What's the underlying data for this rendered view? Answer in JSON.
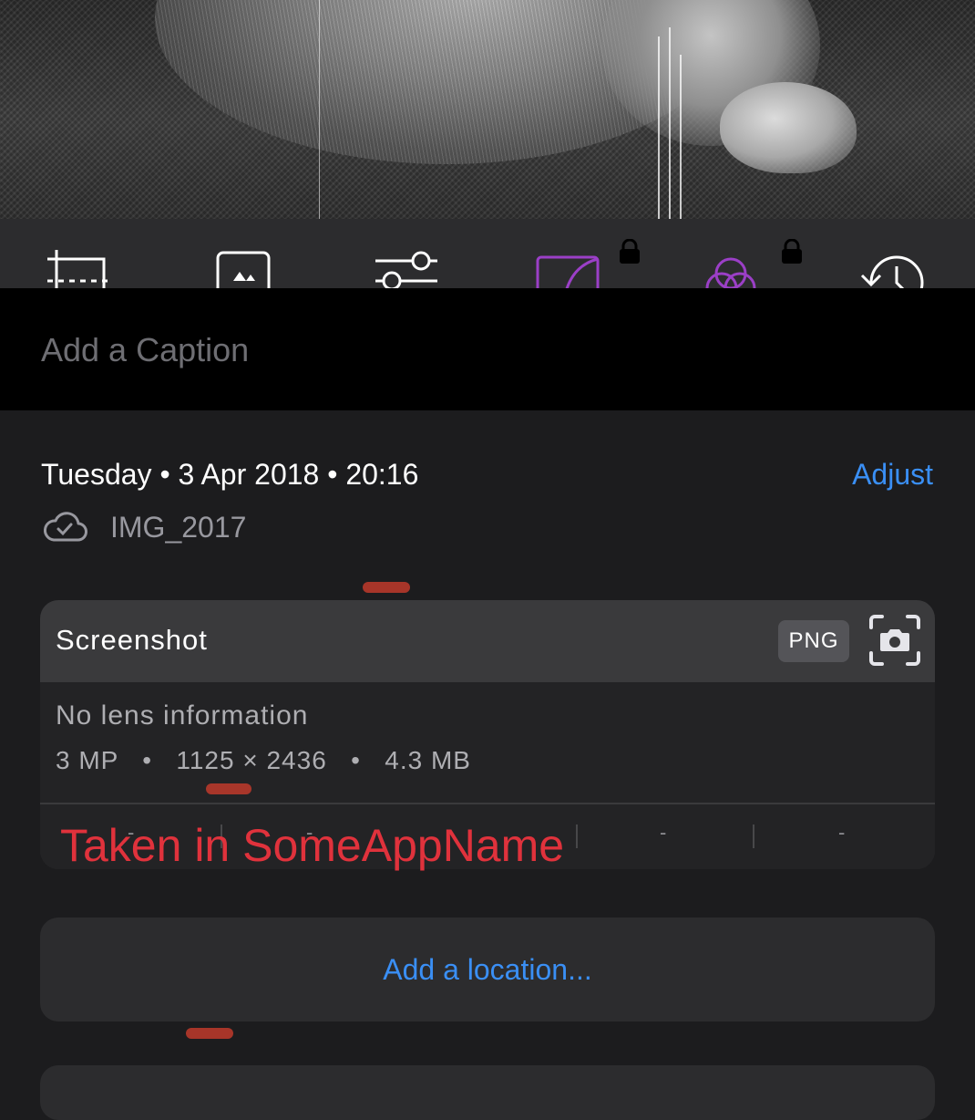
{
  "photo": {
    "subject": ""
  },
  "toolbar": {
    "tools": [
      {
        "name": "crop-icon"
      },
      {
        "name": "frame-icon"
      },
      {
        "name": "adjust-sliders-icon"
      },
      {
        "name": "curves-icon",
        "locked": true
      },
      {
        "name": "filters-icon",
        "locked": true
      },
      {
        "name": "history-icon"
      }
    ],
    "active_color": "#9b3fc7",
    "lock_icon": "lock-icon"
  },
  "caption": {
    "placeholder": "Add a Caption",
    "value": ""
  },
  "info": {
    "day": "Tuesday",
    "date": "3 Apr 2018",
    "time": "20:16",
    "separator": "•",
    "adjust_label": "Adjust",
    "file_name": "IMG_2017",
    "cloud_icon": "icloud-synced-icon"
  },
  "metadata": {
    "title": "Screenshot",
    "format": "PNG",
    "camera_icon": "screenshot-camera-icon",
    "lens": "No lens information",
    "megapixels": "3 MP",
    "dimensions": "1125 × 2436",
    "file_size": "4.3 MB",
    "spec_separator": "•",
    "exif_values": [
      "-",
      "-",
      "-",
      "-",
      "-"
    ],
    "overlay_annotation": "Taken in SomeAppName"
  },
  "location": {
    "label": "Add a location..."
  },
  "colors": {
    "accent_blue": "#3a8ff5",
    "annotation_red": "#e0323c",
    "background": "#1c1c1e"
  }
}
